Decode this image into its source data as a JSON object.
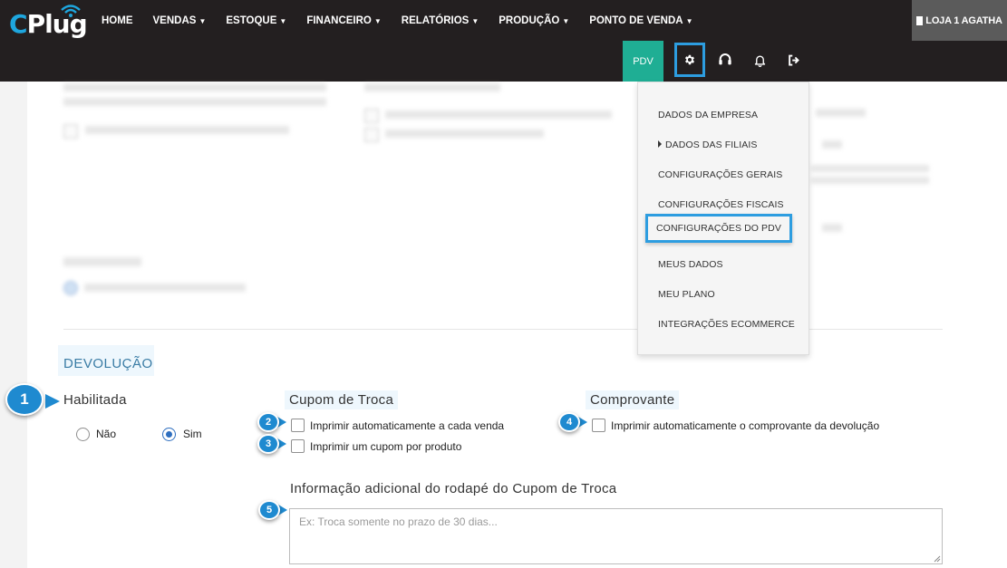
{
  "header": {
    "logo_text": "CPlug",
    "nav": [
      {
        "label": "HOME",
        "caret": false
      },
      {
        "label": "VENDAS",
        "caret": true
      },
      {
        "label": "ESTOQUE",
        "caret": true
      },
      {
        "label": "FINANCEIRO",
        "caret": true
      },
      {
        "label": "RELATÓRIOS",
        "caret": true
      },
      {
        "label": "PRODUÇÃO",
        "caret": true
      },
      {
        "label": "PONTO DE VENDA",
        "caret": true
      }
    ],
    "store_label": "LOJA 1 AGATHA",
    "pdv_label": "PDV",
    "icons": [
      "gear-icon",
      "headset-icon",
      "bell-icon",
      "logout-icon"
    ]
  },
  "settings_menu": {
    "items": [
      {
        "label": "DADOS DA EMPRESA"
      },
      {
        "label": "DADOS DAS FILIAIS"
      },
      {
        "label": "CONFIGURAÇÕES GERAIS"
      },
      {
        "label": "CONFIGURAÇÕES FISCAIS"
      },
      {
        "label": "CONFIGURAÇÕES DO PDV"
      },
      {
        "label": "MEUS DADOS"
      },
      {
        "label": "MEU PLANO"
      },
      {
        "label": "INTEGRAÇÕES ECOMMERCE"
      }
    ]
  },
  "devolucao": {
    "section_title": "DEVOLUÇÃO",
    "habilitada": {
      "label": "Habilitada",
      "options": [
        "Não",
        "Sim"
      ],
      "selected": "Sim"
    },
    "cupom_troca": {
      "label": "Cupom de Troca",
      "options": [
        "Imprimir automaticamente a cada venda",
        "Imprimir um cupom por produto"
      ]
    },
    "comprovante": {
      "label": "Comprovante",
      "option": "Imprimir automaticamente o comprovante da devolução"
    },
    "rodape": {
      "label": "Informação adicional do rodapé do Cupom de Troca",
      "placeholder": "Ex: Troca somente no prazo de 30 dias..."
    }
  },
  "markers": [
    "1",
    "2",
    "3",
    "4",
    "5"
  ],
  "colors": {
    "header_bg": "#231f20",
    "pdv": "#1fae94",
    "highlight": "#2d9de0",
    "marker": "#1f8ad0"
  }
}
